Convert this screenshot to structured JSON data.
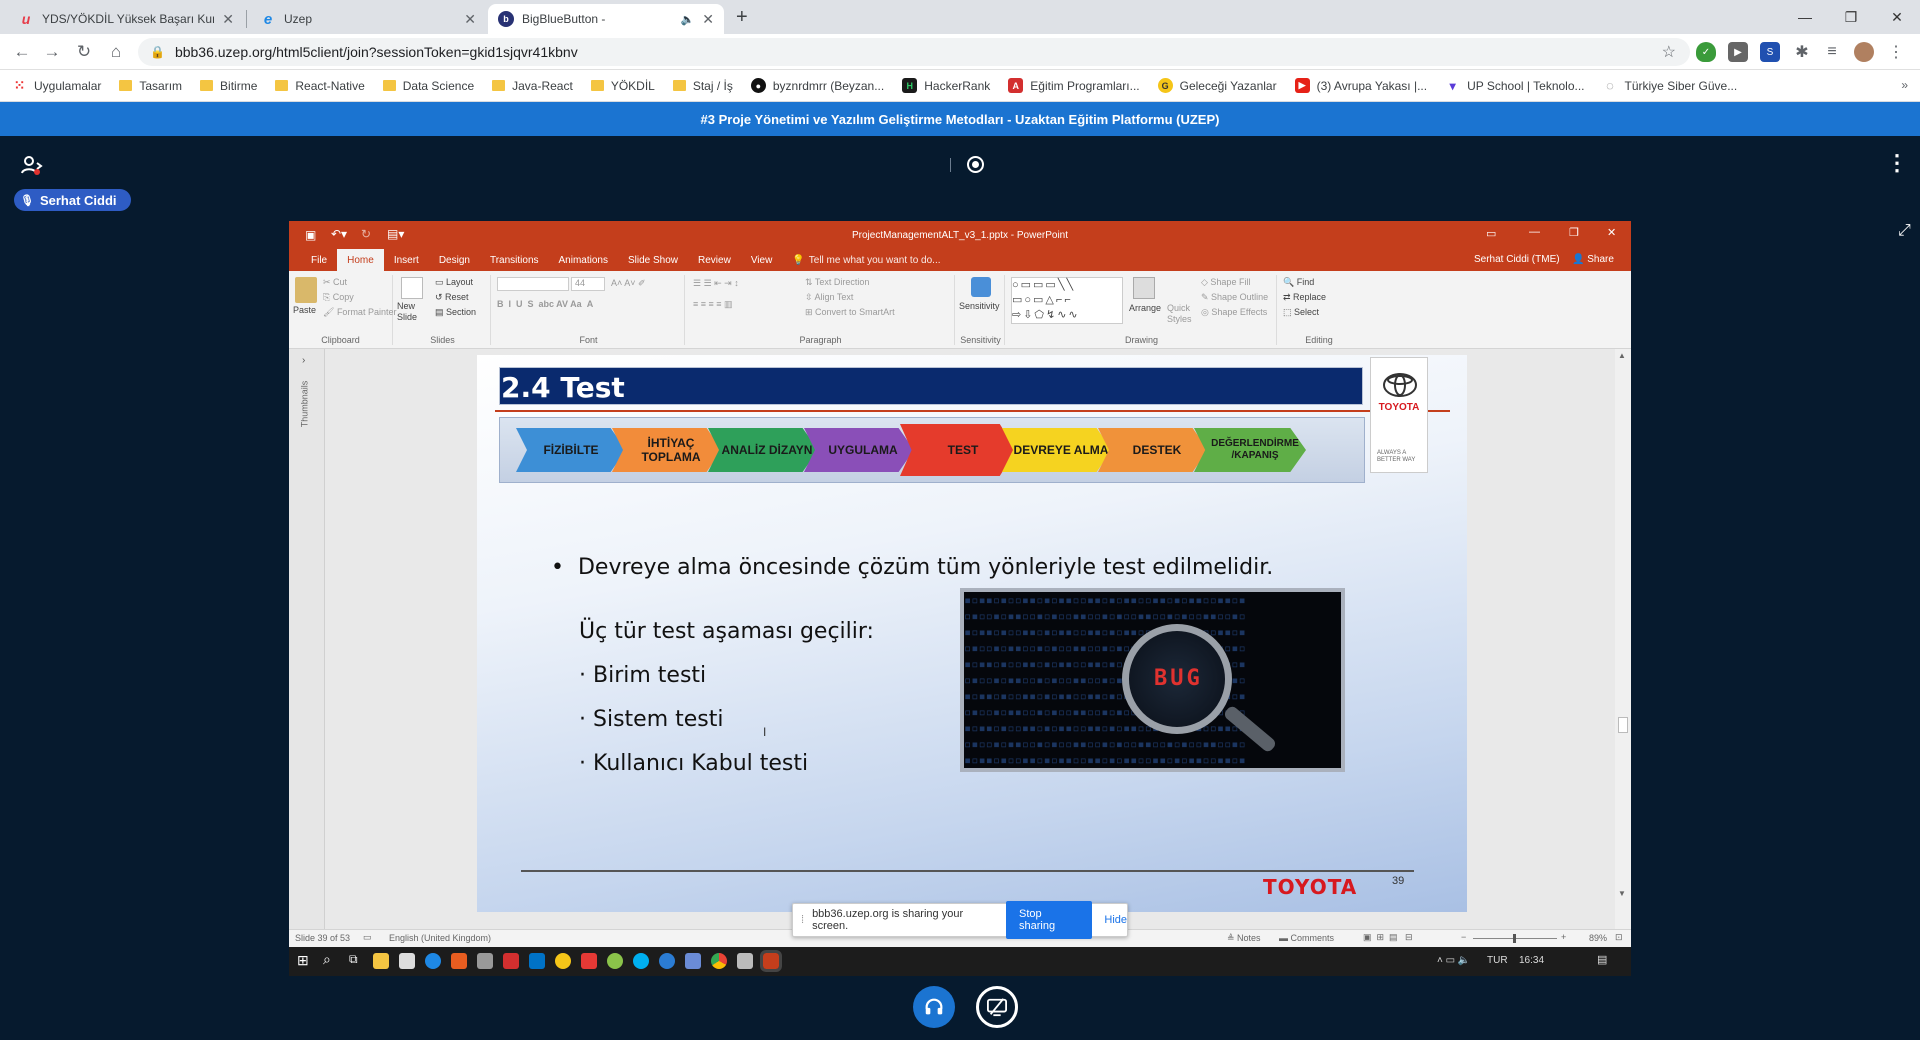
{
  "browser": {
    "tabs": [
      {
        "title": "YDS/YÖKDİL Yüksek Başarı Kursu",
        "icon": "udemy-icon"
      },
      {
        "title": "Uzep",
        "icon": "edge-icon"
      },
      {
        "title": "BigBlueButton -",
        "icon": "bigbluebutton-icon",
        "active": true
      }
    ],
    "url": "bbb36.uzep.org/html5client/join?sessionToken=gkid1sjqvr41kbnv",
    "bookmarks": [
      {
        "label": "Uygulamalar",
        "type": "apps"
      },
      {
        "label": "Tasarım",
        "type": "folder"
      },
      {
        "label": "Bitirme",
        "type": "folder"
      },
      {
        "label": "React-Native",
        "type": "folder"
      },
      {
        "label": "Data Science",
        "type": "folder"
      },
      {
        "label": "Java-React",
        "type": "folder"
      },
      {
        "label": "YÖKDİL",
        "type": "folder"
      },
      {
        "label": "Staj / İş",
        "type": "folder"
      },
      {
        "label": "byznrdmrr (Beyzan...",
        "type": "github"
      },
      {
        "label": "HackerRank",
        "type": "hackerrank"
      },
      {
        "label": "Eğitim Programları...",
        "type": "pdf"
      },
      {
        "label": "Geleceği Yazanlar",
        "type": "gy"
      },
      {
        "label": "(3) Avrupa Yakası |...",
        "type": "youtube"
      },
      {
        "label": "UP School | Teknolo...",
        "type": "up"
      },
      {
        "label": "Türkiye Siber Güve...",
        "type": "siber"
      }
    ]
  },
  "bbb": {
    "header_title": "#3 Proje Yönetimi ve Yazılım Geliştirme Metodları - Uzaktan Eğitim Platformu (UZEP)",
    "user_name": "Serhat Ciddi",
    "sharing_text": "bbb36.uzep.org is sharing your screen.",
    "stop_sharing": "Stop sharing",
    "hide": "Hide"
  },
  "powerpoint": {
    "window_title": "ProjectManagementALT_v3_1.pptx - PowerPoint",
    "account": "Serhat Ciddi (TME)",
    "share": "Share",
    "tabs": [
      "File",
      "Home",
      "Insert",
      "Design",
      "Transitions",
      "Animations",
      "Slide Show",
      "Review",
      "View"
    ],
    "tell_me": "Tell me what you want to do...",
    "ribbon": {
      "paste": "Paste",
      "cut": "Cut",
      "copy": "Copy",
      "format_painter": "Format Painter",
      "clipboard": "Clipboard",
      "new_slide": "New Slide",
      "layout": "Layout",
      "reset": "Reset",
      "section": "Section",
      "slides": "Slides",
      "font_size": "44",
      "font": "Font",
      "text_direction": "Text Direction",
      "align_text": "Align Text",
      "convert_smartart": "Convert to SmartArt",
      "paragraph": "Paragraph",
      "sensitivity": "Sensitivity",
      "arrange": "Arrange",
      "quick_styles": "Quick Styles",
      "shape_fill": "Shape Fill",
      "shape_outline": "Shape Outline",
      "shape_effects": "Shape Effects",
      "drawing": "Drawing",
      "find": "Find",
      "replace": "Replace",
      "select": "Select",
      "editing": "Editing"
    },
    "thumbnails_label": "Thumbnails",
    "status": {
      "slide": "Slide 39 of 53",
      "language": "English (United Kingdom)",
      "notes": "Notes",
      "comments": "Comments",
      "zoom": "89%"
    },
    "taskbar": {
      "lang": "TUR",
      "time": "16:34"
    }
  },
  "slide": {
    "title": "2.4 Test",
    "steps": [
      {
        "label": "FİZİBİLTE",
        "color": "#3d8fd6"
      },
      {
        "label": "İHTİYAÇ TOPLAMA",
        "color": "#f28c3a"
      },
      {
        "label": "ANALİZ DİZAYN",
        "color": "#2ea05a"
      },
      {
        "label": "UYGULAMA",
        "color": "#8a4fb8"
      },
      {
        "label": "TEST",
        "color": "#e53b2c"
      },
      {
        "label": "DEVREYE ALMA",
        "color": "#f5d320"
      },
      {
        "label": "DESTEK",
        "color": "#f0923a"
      },
      {
        "label": "DEĞERLENDİRME /KAPANIŞ",
        "color": "#5fae47"
      }
    ],
    "bullet": "Devreye alma öncesinde çözüm tüm yönleriyle test edilmelidir.",
    "subheading": "Üç tür test aşaması geçilir:",
    "items": [
      "Birim testi",
      "Sistem testi",
      "Kullanıcı Kabul testi"
    ],
    "bug_text": "BUG",
    "logo_text": "TOYOTA",
    "logo_tagline": "ALWAYS A BETTER WAY",
    "footer_brand": "TOYOTA",
    "page_number": "39"
  }
}
